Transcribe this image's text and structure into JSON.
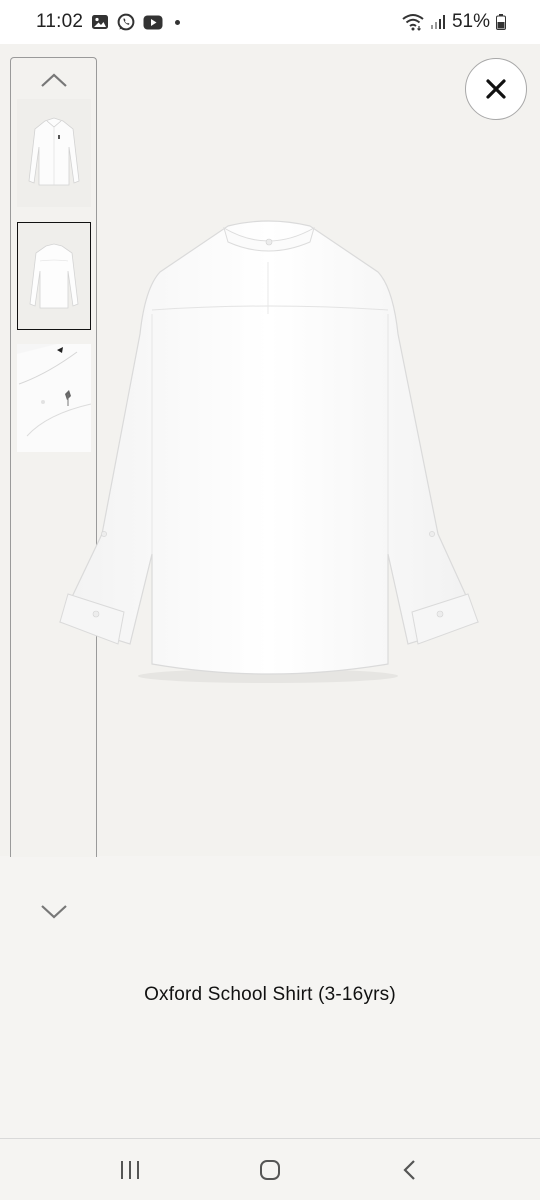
{
  "status_bar": {
    "time": "11:02",
    "battery": "51%",
    "notification_icons": [
      "gallery-icon",
      "whatsapp-icon",
      "youtube-icon"
    ],
    "system_icons": [
      "wifi-icon",
      "signal-icon",
      "battery-icon"
    ]
  },
  "viewer": {
    "thumbnails": [
      {
        "name": "front-view",
        "selected": false
      },
      {
        "name": "back-view",
        "selected": true
      },
      {
        "name": "detail-view",
        "selected": false
      }
    ],
    "selected_index": 1
  },
  "product": {
    "title": "Oxford School Shirt (3-16yrs)"
  },
  "colors": {
    "background": "#f5f4f2",
    "image_bg": "#f3f2ef",
    "text": "#111111",
    "border": "#9a9a9a"
  },
  "nav": {
    "buttons": [
      "recent-apps",
      "home",
      "back"
    ]
  }
}
